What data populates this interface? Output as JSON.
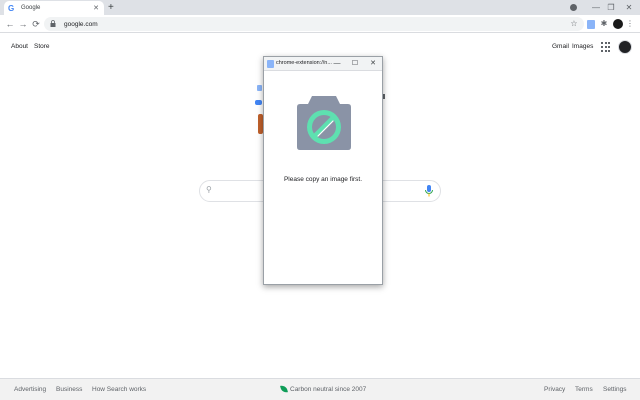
{
  "browser": {
    "tab": {
      "favicon": "G",
      "title": "Google",
      "close": "✕"
    },
    "new_tab": "+",
    "window_controls": {
      "minimize": "—",
      "restore": "❐",
      "close": "✕"
    },
    "nav": {
      "back": "←",
      "forward": "→",
      "reload": "⟳"
    },
    "omnibox": {
      "lock_icon": "lock-icon",
      "url": "google.com"
    },
    "toolbar_icons": {
      "star": "☆",
      "extensions": "✱",
      "menu": "⋮"
    }
  },
  "google": {
    "top_left_links": [
      "About",
      "Store"
    ],
    "top_right_links": [
      "Gmail",
      "Images"
    ],
    "search_icon": "⚲"
  },
  "footer": {
    "left_links": [
      "Advertising",
      "Business",
      "How Search works"
    ],
    "center_text": "Carbon neutral since 2007",
    "right_links": [
      "Privacy",
      "Terms",
      "Settings"
    ]
  },
  "popup": {
    "title": "chrome-extension://n...",
    "controls": {
      "minimize": "—",
      "maximize": "☐",
      "close": "✕"
    },
    "message": "Please copy an image first.",
    "colors": {
      "camera_body": "#8a93a6",
      "accent": "#5ee0b0"
    }
  }
}
